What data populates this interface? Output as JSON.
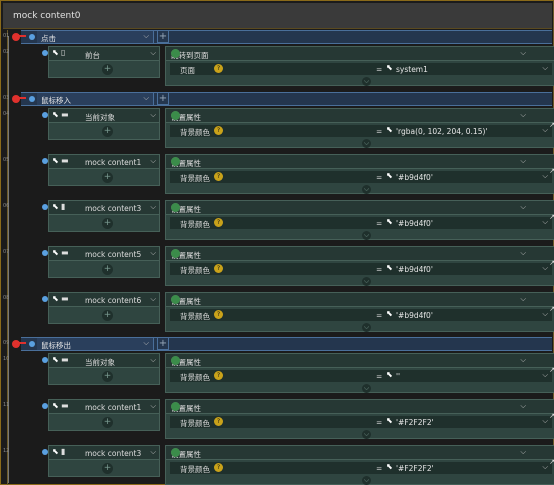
{
  "window": {
    "title": "mock content0"
  },
  "line_numbers": [
    "01",
    "02",
    "03",
    "04",
    "05",
    "06",
    "07",
    "08",
    "09",
    "10",
    "11",
    "12"
  ],
  "events": [
    {
      "label": "点击"
    },
    {
      "label": "鼠标移入"
    },
    {
      "label": "鼠标移出"
    }
  ],
  "targets": [
    {
      "icon": "phone-icon",
      "name": "前台"
    },
    {
      "icon": "component-icon",
      "name": "当前对象"
    },
    {
      "icon": "component-icon",
      "name": "mock content1"
    },
    {
      "icon": "component-icon",
      "name": "mock content3"
    },
    {
      "icon": "component-icon",
      "name": "mock content5"
    },
    {
      "icon": "component-icon",
      "name": "mock content6"
    },
    {
      "icon": "component-icon",
      "name": "当前对象"
    },
    {
      "icon": "component-icon",
      "name": "mock content1"
    },
    {
      "icon": "component-icon",
      "name": "mock content3"
    }
  ],
  "actions": [
    {
      "title": "跳转到页面",
      "prop_label": "页面",
      "value": "system1"
    },
    {
      "title": "设置属性",
      "prop_label": "背景颜色",
      "value": "'rgba(0, 102, 204, 0.15)'"
    },
    {
      "title": "设置属性",
      "prop_label": "背景颜色",
      "value": "'#b9d4f0'"
    },
    {
      "title": "设置属性",
      "prop_label": "背景颜色",
      "value": "'#b9d4f0'"
    },
    {
      "title": "设置属性",
      "prop_label": "背景颜色",
      "value": "'#b9d4f0'"
    },
    {
      "title": "设置属性",
      "prop_label": "背景颜色",
      "value": "'#b9d4f0'"
    },
    {
      "title": "设置属性",
      "prop_label": "背景颜色",
      "value": "''"
    },
    {
      "title": "设置属性",
      "prop_label": "背景颜色",
      "value": "'#F2F2F2'"
    },
    {
      "title": "设置属性",
      "prop_label": "背景颜色",
      "value": "'#F2F2F2'"
    }
  ],
  "symbols": {
    "plus": "+",
    "chevron": "⌵",
    "eq": "=",
    "question": "?",
    "pointer": "⬉",
    "expand": "↗"
  },
  "colors": {
    "event_bg": "#24364e",
    "block_bg": "#2f4540",
    "delete_dot": "#e0312d",
    "enable_dot": "#3b8c4a",
    "accent_blue": "#5aa0e0"
  }
}
